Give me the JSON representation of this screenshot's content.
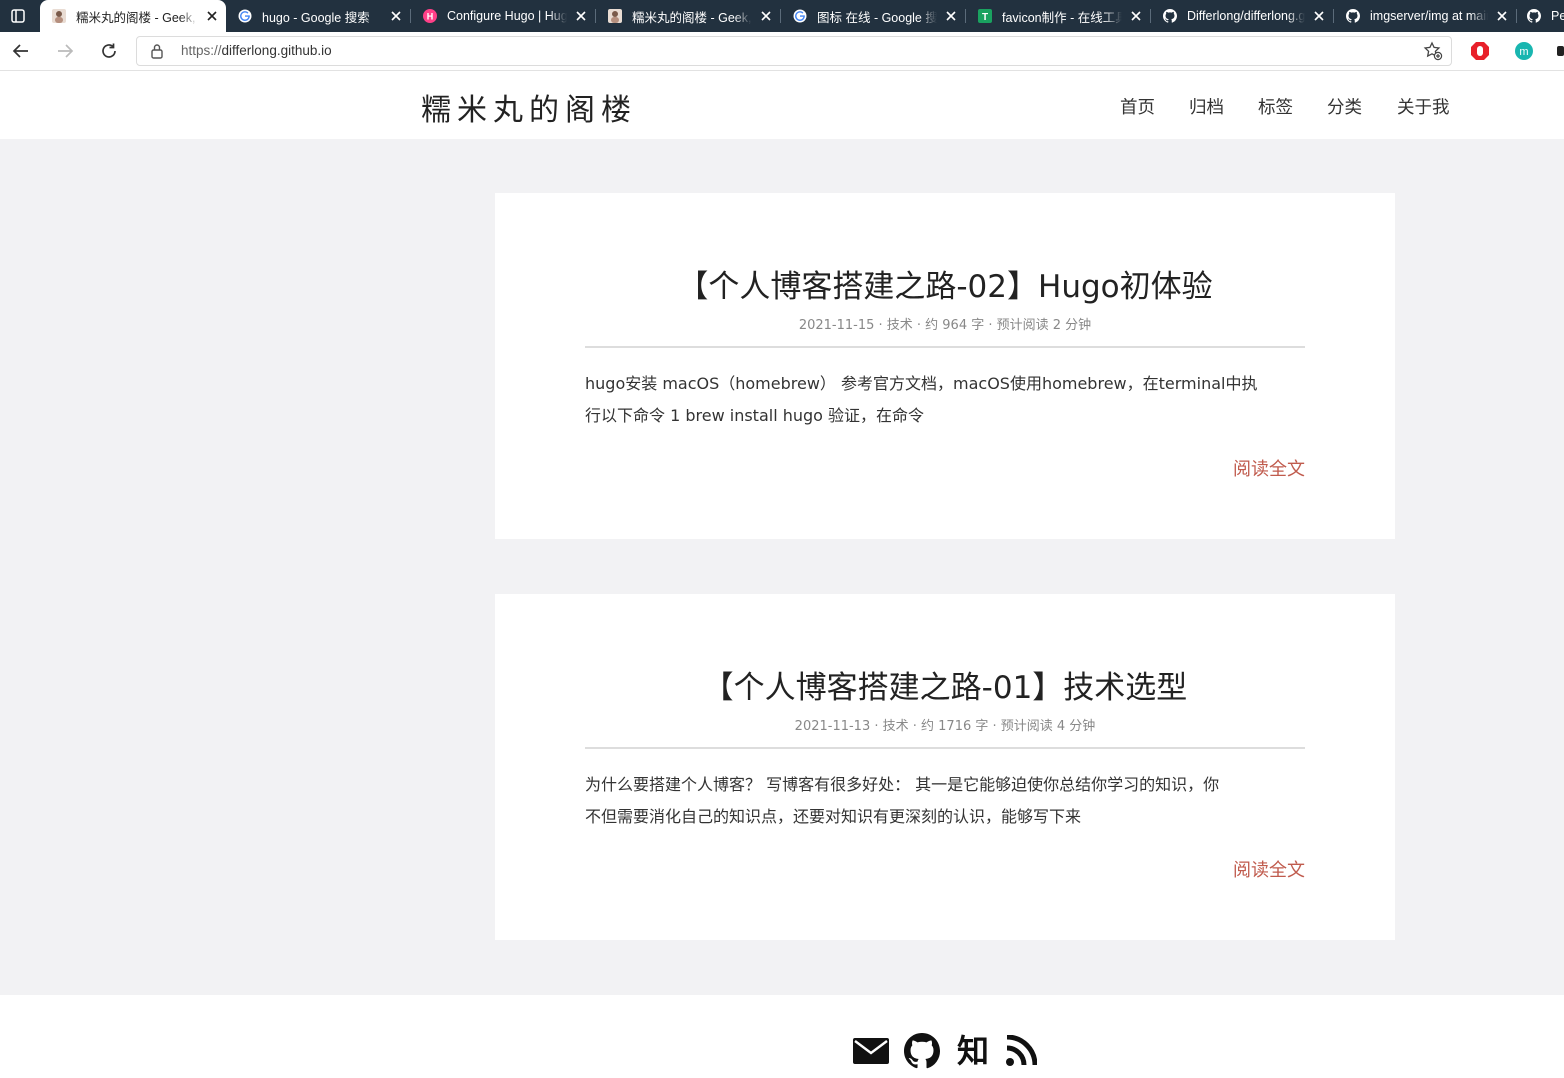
{
  "browser": {
    "tabs": [
      {
        "title": "糯米丸的阁楼 - Geek, Creative",
        "favicon": "avatar-icon",
        "active": true
      },
      {
        "title": "hugo - Google 搜索",
        "favicon": "google-icon",
        "active": false
      },
      {
        "title": "Configure Hugo | Hugo",
        "favicon": "hugo-icon",
        "active": false
      },
      {
        "title": "糯米丸的阁楼 - Geek, Creative",
        "favicon": "avatar-icon",
        "active": false
      },
      {
        "title": "图标 在线 - Google 搜索",
        "favicon": "google-icon",
        "active": false
      },
      {
        "title": "favicon制作 - 在线工具",
        "favicon": "tool-icon",
        "active": false
      },
      {
        "title": "Differlong/differlong.github.io",
        "favicon": "github-icon",
        "active": false
      },
      {
        "title": "imgserver/img at main",
        "favicon": "github-icon",
        "active": false
      },
      {
        "title": "Pe",
        "favicon": "github-icon",
        "active": false
      }
    ],
    "url_scheme": "https://",
    "url_host": "differlong.github.io"
  },
  "site": {
    "title": "糯米丸的阁楼",
    "menu": [
      "首页",
      "归档",
      "标签",
      "分类",
      "关于我"
    ]
  },
  "posts": [
    {
      "title": "【个人博客搭建之路-02】Hugo初体验",
      "meta": "2021-11-15 · 技术 · 约 964 字 · 预计阅读 2 分钟",
      "summary": "hugo安装 macOS（homebrew） 参考官方文档，macOS使用homebrew，在terminal中执行以下命令 1 brew install hugo 验证，在命令",
      "summary_line1": "hugo安装 macOS（homebrew） 参考官方文档，macOS使用homebrew，在terminal中执",
      "summary_line2": "行以下命令 1 brew install hugo 验证，在命令",
      "read_more": "阅读全文"
    },
    {
      "title": "【个人博客搭建之路-01】技术选型",
      "meta": "2021-11-13 · 技术 · 约 1716 字 · 预计阅读 4 分钟",
      "summary": "为什么要搭建个人博客? 写博客有很多好处： 其一是它能够迫使你总结你学习的知识，你不但需要消化自己的知识点，还要对知识有更深刻的认识，能够写下来",
      "summary_line1": "为什么要搭建个人博客？ 写博客有很多好处： 其一是它能够迫使你总结你学习的知识，你",
      "summary_line2": "不但需要消化自己的知识点，还要对知识有更深刻的认识，能够写下来",
      "read_more": "阅读全文"
    }
  ],
  "footer": {
    "icons": [
      "mail-icon",
      "github-icon",
      "zhihu-icon",
      "rss-icon"
    ],
    "zhihu_glyph": "知"
  },
  "colors": {
    "tabbar": "#22313f",
    "background": "#f2f2f4",
    "accent": "#c05b4d"
  }
}
